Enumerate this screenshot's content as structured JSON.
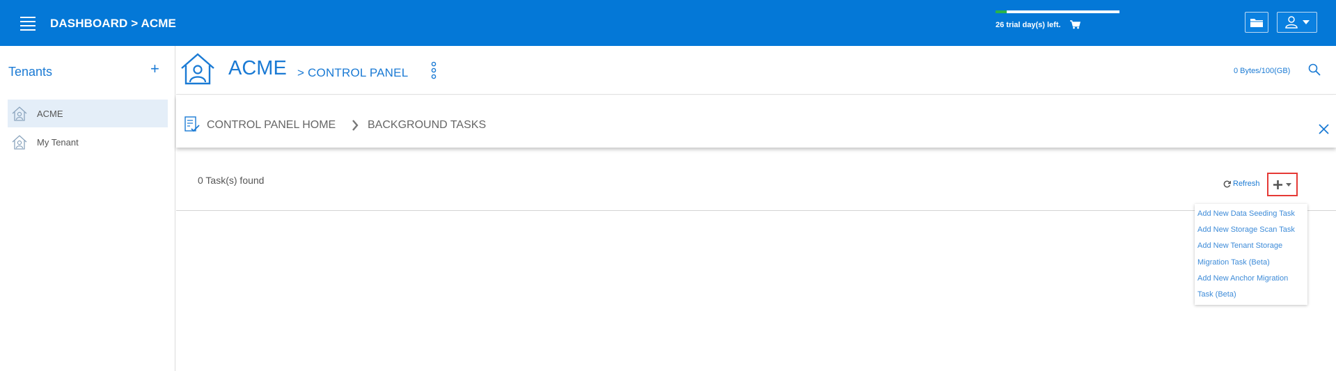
{
  "app": {
    "breadcrumb": "DASHBOARD > ACME"
  },
  "trial": {
    "text": "26 trial day(s) left.",
    "progress_fraction": 0.09,
    "bar_color": "#29b34a"
  },
  "topbar_icons": [
    "menu-icon",
    "cart-icon",
    "folder-icon",
    "user-icon",
    "caret-down-icon"
  ],
  "sidebar": {
    "title": "Tenants",
    "add_symbol": "+",
    "items": [
      {
        "label": "ACME",
        "active": true
      },
      {
        "label": "My Tenant",
        "active": false
      }
    ]
  },
  "header": {
    "tenant_name": "ACME",
    "crumb": "> CONTROL PANEL",
    "quota": "0 Bytes/100(GB)"
  },
  "subheader": {
    "home": "CONTROL PANEL HOME",
    "current": "BACKGROUND TASKS"
  },
  "content": {
    "task_count": "0 Task(s) found",
    "refresh_label": "Refresh",
    "add_menu": [
      "Add New Data Seeding Task",
      "Add New Storage Scan Task",
      "Add New Tenant Storage",
      "Migration Task (Beta)",
      "Add New Anchor Migration",
      "Task (Beta)"
    ]
  },
  "colors": {
    "topbar": "#0478d7",
    "accent": "#1a7ad4",
    "highlight_border": "#e53935",
    "active_item_bg": "#e4eef8"
  }
}
